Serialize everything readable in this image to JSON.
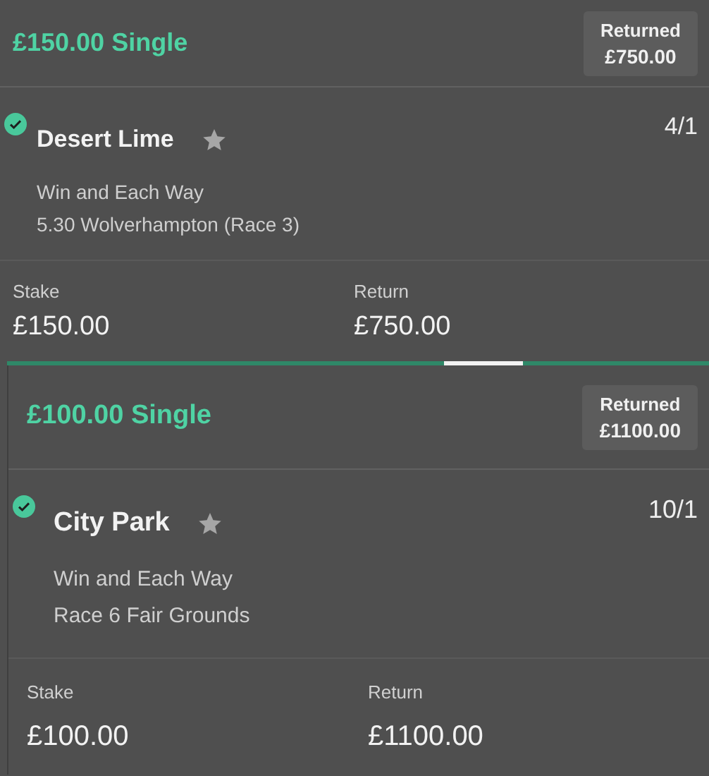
{
  "bets": [
    {
      "title": "£150.00 Single",
      "returned_label": "Returned",
      "returned_amount": "£750.00",
      "selection": {
        "name": "Desert Lime",
        "won": true,
        "odds": "4/1",
        "market": "Win and Each Way",
        "event": "5.30 Wolverhampton (Race 3)"
      },
      "stake_label": "Stake",
      "stake": "£150.00",
      "return_label": "Return",
      "return": "£750.00"
    },
    {
      "title": "£100.00 Single",
      "returned_label": "Returned",
      "returned_amount": "£1100.00",
      "selection": {
        "name": "City Park",
        "won": true,
        "odds": "10/1",
        "market": "Win and Each Way",
        "event": "Race 6 Fair Grounds"
      },
      "stake_label": "Stake",
      "stake": "£100.00",
      "return_label": "Return",
      "return": "£1100.00"
    }
  ]
}
